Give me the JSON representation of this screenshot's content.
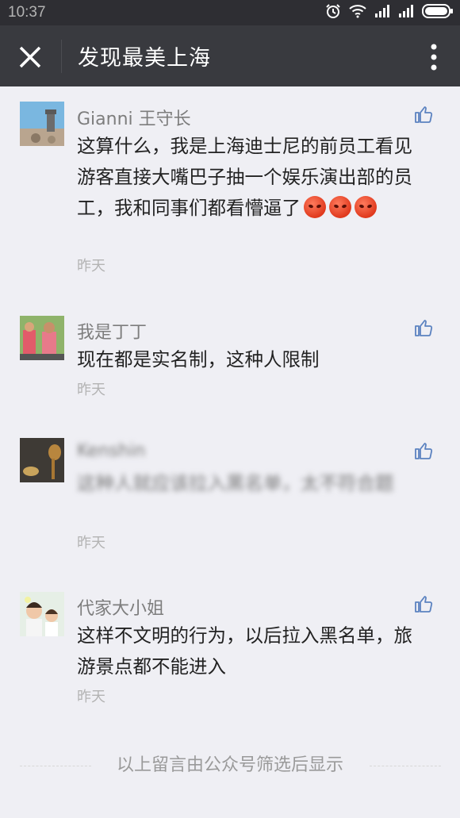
{
  "status": {
    "time": "10:37"
  },
  "header": {
    "title": "发现最美上海"
  },
  "comments": [
    {
      "name": "Gianni 王守长",
      "text": "这算什么，我是上海迪士尼的前员工看见游客直接大嘴巴子抽一个娱乐演出部的员工，我和同事们都看懵逼了",
      "emoji_count": 3,
      "time": "昨天"
    },
    {
      "name": "我是丁丁",
      "text": "现在都是实名制，这种人限制",
      "time": "昨天"
    },
    {
      "name": "Kenshin",
      "text": "这种人就应该拉入黑名单，太不符合题",
      "time": "昨天"
    },
    {
      "name": "代家大小姐",
      "text": "这样不文明的行为，以后拉入黑名单，旅游景点都不能进入",
      "time": "昨天"
    }
  ],
  "footer": {
    "text": "以上留言由公众号筛选后显示"
  },
  "icons": {
    "alarm": "alarm-icon",
    "wifi": "wifi-icon",
    "signal": "signal-icon",
    "battery": "battery-icon",
    "close": "close-icon",
    "more": "more-vertical-icon",
    "like": "thumbs-up-icon"
  }
}
